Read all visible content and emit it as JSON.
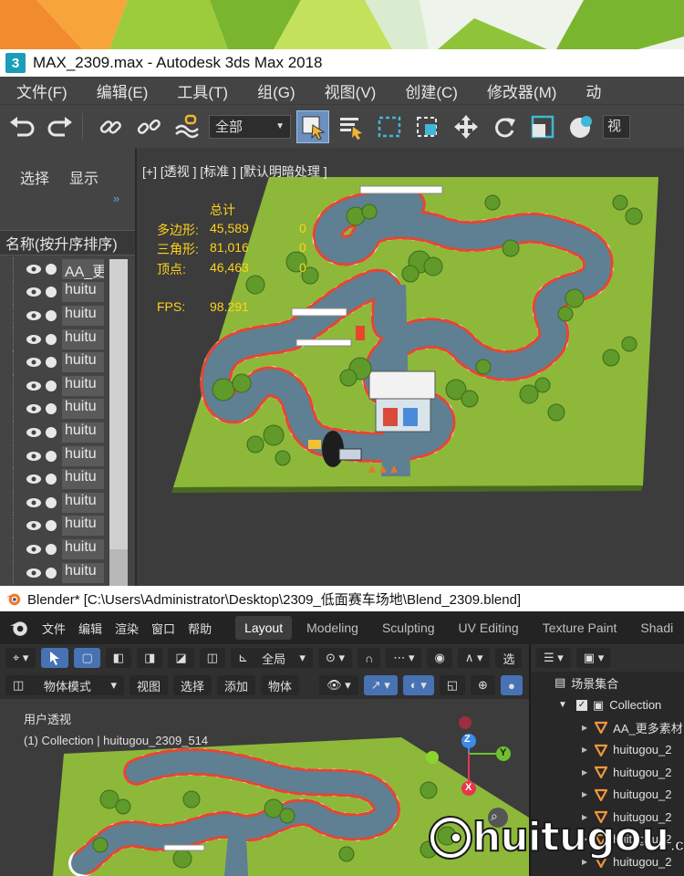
{
  "max": {
    "title": "MAX_2309.max - Autodesk 3ds Max 2018",
    "logo_text": "3",
    "menu": [
      "文件(F)",
      "编辑(E)",
      "工具(T)",
      "组(G)",
      "视图(V)",
      "创建(C)",
      "修改器(M)",
      "动"
    ],
    "toolbar": {
      "selection_filter": "全部",
      "viewport_cut": "视"
    },
    "scene_explorer": {
      "tabs": [
        "选择",
        "显示"
      ],
      "column_header": "名称(按升序排序)",
      "rows": [
        "AA_更",
        "huitu",
        "huitu",
        "huitu",
        "huitu",
        "huitu",
        "huitu",
        "huitu",
        "huitu",
        "huitu",
        "huitu",
        "huitu",
        "huitu",
        "huitu"
      ]
    },
    "viewport": {
      "label": "[+] [透视 ] [标准 ] [默认明暗处理 ]",
      "stats": {
        "header": "总计",
        "polygons_label": "多边形:",
        "polygons_value": "45,589",
        "polygons_sel": "0",
        "triangles_label": "三角形:",
        "triangles_value": "81,016",
        "triangles_sel": "0",
        "vertices_label": "顶点:",
        "vertices_value": "46,463",
        "vertices_sel": "0",
        "fps_label": "FPS:",
        "fps_value": "98.291"
      }
    }
  },
  "blender": {
    "title": "Blender* [C:\\Users\\Administrator\\Desktop\\2309_低面赛车场地\\Blend_2309.blend]",
    "menu": [
      "文件",
      "编辑",
      "渲染",
      "窗口",
      "帮助"
    ],
    "workspaces": [
      "Layout",
      "Modeling",
      "Sculpting",
      "UV Editing",
      "Texture Paint",
      "Shadi"
    ],
    "header1": {
      "transform_orientation": "全局",
      "select_cut": "选"
    },
    "header2": {
      "mode": "物体模式",
      "view": "视图",
      "select": "选择",
      "add": "添加",
      "object": "物体"
    },
    "viewport": {
      "name": "用户透视",
      "info": "(1) Collection | huitugou_2309_514",
      "gizmo": {
        "z": "Z",
        "y": "Y",
        "x": "X"
      }
    },
    "outliner": {
      "scene_collection": "场景集合",
      "collection": "Collection",
      "items": [
        "AA_更多素材",
        "huitugou_2",
        "huitugou_2",
        "huitugou_2",
        "huitugou_2",
        "huitugou_2",
        "huitugou_2"
      ]
    }
  },
  "watermark": {
    "text": "huitugou",
    "suffix": ".com"
  },
  "colors": {
    "max_bg": "#444444",
    "viewport_bg": "#3c3c3c",
    "stats_yellow": "#ffd21a",
    "grass": "#8db83a",
    "track": "#5f7f93",
    "blender_active": "#4772b3"
  }
}
